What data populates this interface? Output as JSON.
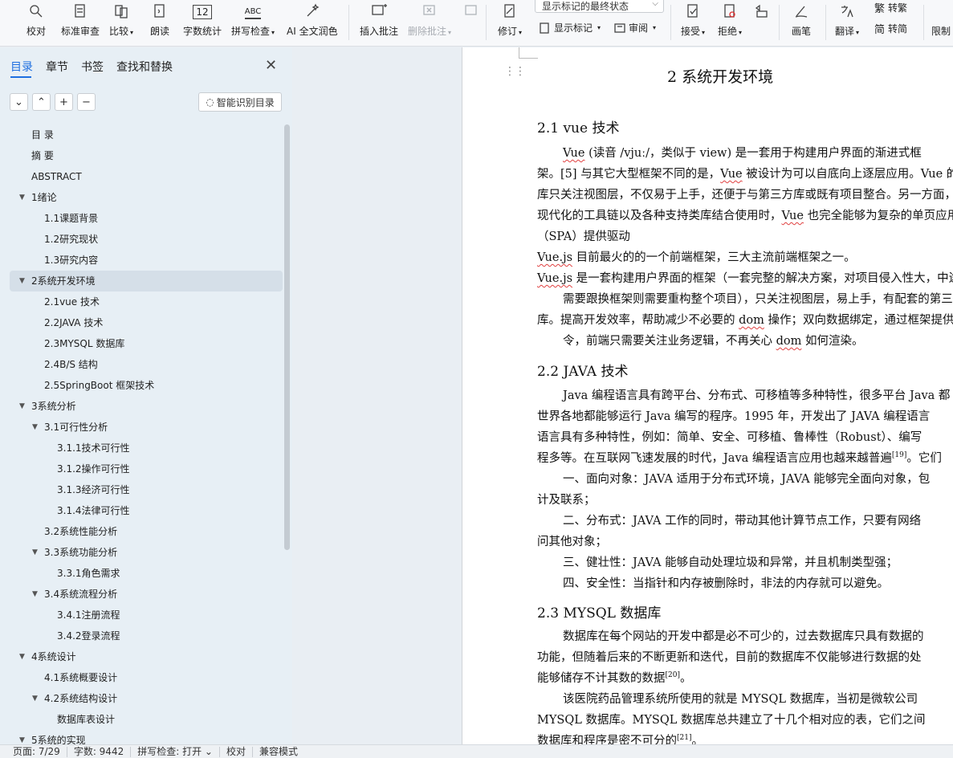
{
  "ribbon": {
    "proofread": "校对",
    "standard_review": "标准审查",
    "compare": "比较",
    "read_aloud": "朗读",
    "word_count": "字数统计",
    "word_count_icon_text": "12",
    "spell_check": "拼写检查",
    "spell_icon_text": "ABC",
    "ai_polish": "AI 全文润色",
    "insert_comment": "插入批注",
    "delete_comment": "删除批注",
    "markup_select": "显示标记的最终状态",
    "revise": "修订",
    "show_markup": "显示标记",
    "review": "审阅",
    "accept": "接受",
    "reject": "拒绝",
    "pen": "画笔",
    "translate": "翻译",
    "to_traditional": "转繁",
    "to_simplified": "转简",
    "restrict": "限制"
  },
  "nav": {
    "tabs": [
      "目录",
      "章节",
      "书签",
      "查找和替换"
    ],
    "smart_toc": "智能识别目录",
    "toc": [
      {
        "label": "目  录",
        "level": 1,
        "arrow": ""
      },
      {
        "label": "摘  要",
        "level": 1,
        "arrow": ""
      },
      {
        "label": "ABSTRACT",
        "level": 1,
        "arrow": ""
      },
      {
        "label": "1绪论",
        "level": 1,
        "arrow": "▼"
      },
      {
        "label": "1.1课题背景",
        "level": 2,
        "arrow": ""
      },
      {
        "label": "1.2研究现状",
        "level": 2,
        "arrow": ""
      },
      {
        "label": "1.3研究内容",
        "level": 2,
        "arrow": ""
      },
      {
        "label": "2系统开发环境",
        "level": 1,
        "arrow": "▼",
        "selected": true
      },
      {
        "label": "2.1vue 技术",
        "level": 2,
        "arrow": ""
      },
      {
        "label": "2.2JAVA 技术",
        "level": 2,
        "arrow": ""
      },
      {
        "label": "2.3MYSQL 数据库",
        "level": 2,
        "arrow": ""
      },
      {
        "label": "2.4B/S 结构",
        "level": 2,
        "arrow": ""
      },
      {
        "label": "2.5SpringBoot 框架技术",
        "level": 2,
        "arrow": ""
      },
      {
        "label": "3系统分析",
        "level": 1,
        "arrow": "▼"
      },
      {
        "label": "3.1可行性分析",
        "level": 2,
        "arrow": "▼"
      },
      {
        "label": "3.1.1技术可行性",
        "level": 3,
        "arrow": ""
      },
      {
        "label": "3.1.2操作可行性",
        "level": 3,
        "arrow": ""
      },
      {
        "label": "3.1.3经济可行性",
        "level": 3,
        "arrow": ""
      },
      {
        "label": "3.1.4法律可行性",
        "level": 3,
        "arrow": ""
      },
      {
        "label": "3.2系统性能分析",
        "level": 2,
        "arrow": ""
      },
      {
        "label": "3.3系统功能分析",
        "level": 2,
        "arrow": "▼"
      },
      {
        "label": "3.3.1角色需求",
        "level": 3,
        "arrow": ""
      },
      {
        "label": "3.4系统流程分析",
        "level": 2,
        "arrow": "▼"
      },
      {
        "label": "3.4.1注册流程",
        "level": 3,
        "arrow": ""
      },
      {
        "label": "3.4.2登录流程",
        "level": 3,
        "arrow": ""
      },
      {
        "label": "4系统设计",
        "level": 1,
        "arrow": "▼"
      },
      {
        "label": "4.1系统概要设计",
        "level": 2,
        "arrow": ""
      },
      {
        "label": "4.2系统结构设计",
        "level": 2,
        "arrow": "▼"
      },
      {
        "label": "数据库表设计",
        "level": 3,
        "arrow": ""
      },
      {
        "label": "5系统的实现",
        "level": 1,
        "arrow": "▼"
      }
    ]
  },
  "doc": {
    "chapter_title": "2  系统开发环境",
    "s21_title": "2.1  vue 技术",
    "p1_vue": "Vue",
    "p1_rest": " (读音  /vjuː/，类似于  view) 是一套用于构建用户界面的渐进式框",
    "p2_a": "架。[5] 与其它大型框架不同的是，",
    "p2_vue": "Vue",
    "p2_b": " 被设计为可以自底向上逐层应用。Vue 的核心",
    "p3": "库只关注视图层，不仅易于上手，还便于与第三方库或既有项目整合。另一方面，当与",
    "p4_a": "现代化的工具链以及各种支持类库结合使用时，",
    "p4_vue": "Vue",
    "p4_b": " 也完全能够为复杂的单页应用",
    "p5": "（SPA）提供驱动",
    "p6_vue": "Vue.js",
    "p6_rest": " 目前最火的的一个前端框架，三大主流前端框架之一。",
    "p7_vue": "Vue.js",
    "p7_rest": " 是一套构建用户界面的框架（一套完整的解决方案，对项目侵入性大，中途",
    "p8": "需要跟换框架则需要重构整个项目），只关注视图层，易上手，有配套的第三方类",
    "p9_a": "库。提高开发效率，帮助减少不必要的 ",
    "p9_dom": "dom",
    "p9_b": " 操作；双向数据绑定，通过框架提供的指",
    "p10_a": "令，前端只需要关注业务逻辑，不再关心 ",
    "p10_dom": "dom",
    "p10_b": " 如何渲染。",
    "s22_title": "2.2  JAVA 技术",
    "j1": "Java 编程语言具有跨平台、分布式、可移植等多种特性，很多平台 Java 都",
    "j2": "世界各地都能够运行 Java 编写的程序。1995 年，开发出了 JAVA 编程语言",
    "j3": "语言具有多种特性，例如：简单、安全、可移植、鲁棒性（Robust）、编写",
    "j4_a": "程多等。在互联网飞速发展的时代，Java 编程语言应用也越来越普遍",
    "j4_sup": "[19]",
    "j4_b": "。它们",
    "j5": "一、面向对象：JAVA 适用于分布式环境，JAVA 能够完全面向对象，包",
    "j6": "计及联系；",
    "j7": "二、分布式：JAVA 工作的同时，带动其他计算节点工作，只要有网络",
    "j8": "问其他对象；",
    "j9": "三、健壮性：JAVA 能够自动处理垃圾和异常，并且机制类型强；",
    "j10": "四、安全性：当指针和内存被删除时，非法的内存就可以避免。",
    "s23_title": "2.3  MYSQL 数据库",
    "m1": "数据库在每个网站的开发中都是必不可少的，过去数据库只具有数据的",
    "m2": "功能，但随着后来的不断更新和迭代，目前的数据库不仅能够进行数据的处",
    "m3_a": "能够储存不计其数的数据",
    "m3_sup": "[20]",
    "m3_b": "。",
    "m4": "该医院药品管理系统所使用的就是 MYSQL 数据库，当初是微软公司",
    "m5": "MYSQL 数据库。MYSQL 数据库总共建立了十几个相对应的表，它们之间",
    "m6_a": "数据库和程序是密不可分的",
    "m6_sup": "[21]",
    "m6_b": "。"
  },
  "status": {
    "page": "页面: 7/29",
    "words": "字数: 9442",
    "spell": "拼写检查: 打开",
    "proof": "校对",
    "compat": "兼容模式"
  }
}
